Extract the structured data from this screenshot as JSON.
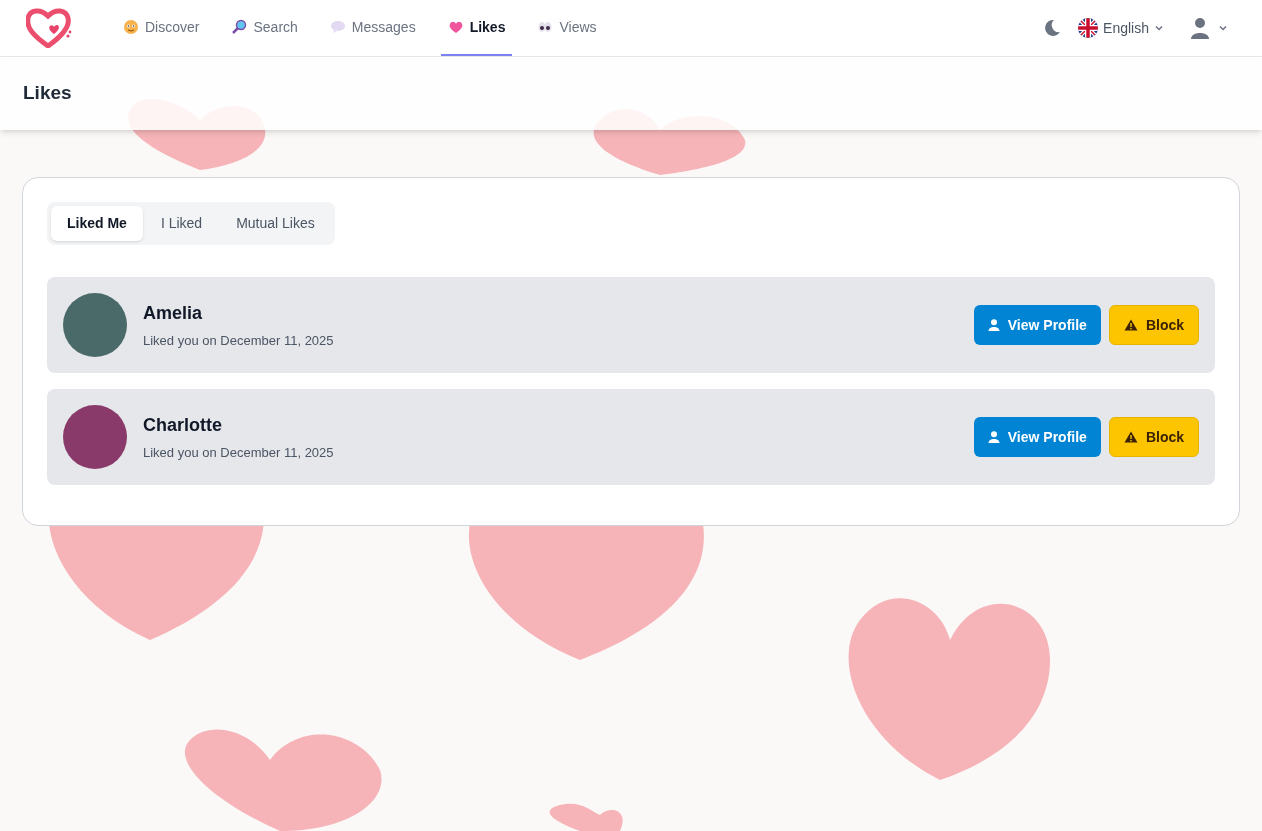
{
  "nav": {
    "items": [
      {
        "label": "Discover",
        "selected": false
      },
      {
        "label": "Search",
        "selected": false
      },
      {
        "label": "Messages",
        "selected": false
      },
      {
        "label": "Likes",
        "selected": true
      },
      {
        "label": "Views",
        "selected": false
      }
    ],
    "language": "English"
  },
  "page_title": "Likes",
  "tabs": [
    {
      "label": "Liked Me",
      "selected": true
    },
    {
      "label": "I Liked",
      "selected": false
    },
    {
      "label": "Mutual Likes",
      "selected": false
    }
  ],
  "likes": [
    {
      "name": "Amelia",
      "subtitle": "Liked you on December 11, 2025",
      "actions": [
        "View Profile",
        "Block"
      ]
    },
    {
      "name": "Charlotte",
      "subtitle": "Liked you on December 11, 2025",
      "actions": [
        "View Profile",
        "Block"
      ]
    }
  ]
}
